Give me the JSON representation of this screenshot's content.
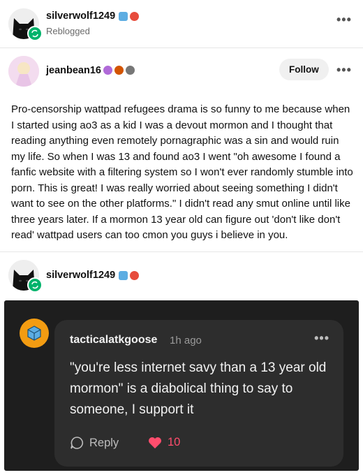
{
  "reblog_header": {
    "username": "silverwolf1249",
    "status": "Reblogged"
  },
  "original_post": {
    "username": "jeanbean16",
    "follow_label": "Follow",
    "body": "Pro-censorship wattpad refugees drama is so funny to me because when I started using ao3 as a kid I was a devout mormon and I thought that reading anything even remotely pornagraphic was a sin and would ruin my life. So when I was 13 and found ao3 I went \"oh awesome I found a fanfic website with a filtering system so I won't ever randomly stumble into porn. This is great! I was really worried about seeing something I didn't want to see on the other platforms.\" I didn't read any smut online until like three years later. If a mormon 13 year old can figure out 'don't like don't read' wattpad users can too cmon you guys i believe in you."
  },
  "reblog_entry": {
    "username": "silverwolf1249"
  },
  "reply": {
    "username": "tacticalatkgoose",
    "time": "1h ago",
    "text": "\"you're less internet savy than a 13 year old mormon\" is a diabolical thing to say to someone, I support it",
    "reply_label": "Reply",
    "likes": "10"
  },
  "colors": {
    "reblog_green": "#00b36b",
    "like_red": "#ff4d6d",
    "dark_bg": "#1e1e1e",
    "card_bg": "#2d2d2d"
  }
}
